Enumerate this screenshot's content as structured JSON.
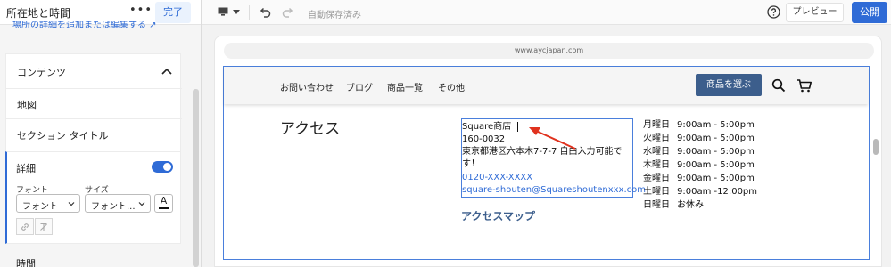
{
  "panel": {
    "title": "所在地と時間",
    "more_label": "•••",
    "done_label": "完了",
    "cut_link_text": "場所の詳細を追加または編集する ↗",
    "content_section": {
      "label": "コンテンツ",
      "items": [
        "地図",
        "セクション タイトル"
      ]
    },
    "details": {
      "label": "詳細",
      "toggle_on": true,
      "font_label": "フォント",
      "size_label": "サイズ",
      "font_value": "フォント",
      "size_value": "フォント...",
      "text_color_glyph": "A",
      "link_glyph": "🔗",
      "clear_glyph": "T̸"
    },
    "time_label": "時間"
  },
  "toolbar": {
    "autosave_text": "自動保存済み",
    "preview_label": "プレビュー",
    "publish_label": "公開"
  },
  "canvas": {
    "url": "www.aycjapan.com"
  },
  "site": {
    "nav": [
      "お問い合わせ",
      "ブログ",
      "商品一覧",
      "その他"
    ],
    "select_button": "商品を選ぶ",
    "heading": "アクセス",
    "address": {
      "shop": "Square商店",
      "zip": "160-0032",
      "street_1": "東京都港区六本木7-7-7 自由入力可能で",
      "street_2": "す！",
      "phone": "0120-XXX-XXXX",
      "email": "square-shouten@Squareshoutenxxx.com"
    },
    "map_link": "アクセスマップ",
    "hours": [
      {
        "day": "月曜日",
        "time": "9:00am - 5:00pm"
      },
      {
        "day": "火曜日",
        "time": "9:00am - 5:00pm"
      },
      {
        "day": "水曜日",
        "time": "9:00am - 5:00pm"
      },
      {
        "day": "木曜日",
        "time": "9:00am - 5:00pm"
      },
      {
        "day": "金曜日",
        "time": "9:00am - 5:00pm"
      },
      {
        "day": "土曜日",
        "time": "9:00am -12:00pm"
      },
      {
        "day": "日曜日",
        "time": "お休み"
      }
    ]
  },
  "colors": {
    "accent": "#2f6bd6",
    "nav_button": "#3c5e8c",
    "annotation_arrow": "#e0321e"
  }
}
